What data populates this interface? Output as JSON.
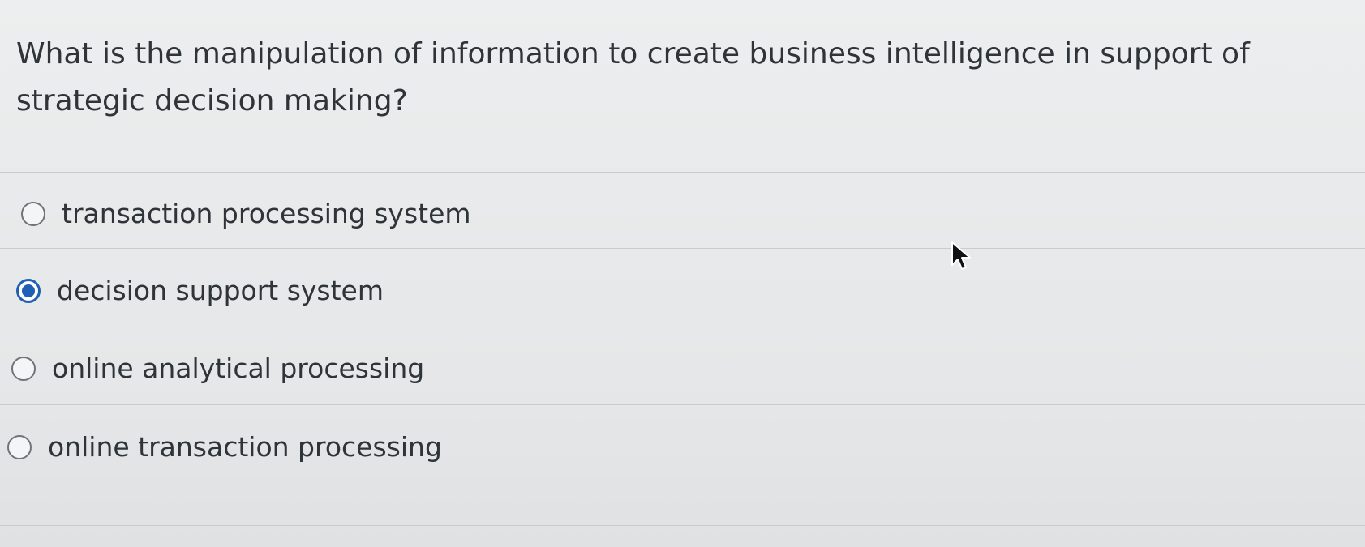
{
  "question": {
    "text": "What is the manipulation of information to create business intelligence in support of strategic decision making?"
  },
  "options": [
    {
      "label": "transaction processing system",
      "selected": false
    },
    {
      "label": "decision support system",
      "selected": true
    },
    {
      "label": "online analytical processing",
      "selected": false
    },
    {
      "label": "online transaction processing",
      "selected": false
    }
  ],
  "colors": {
    "accent": "#1f5fb4",
    "text": "#2e3438",
    "background": "#e8eaeb"
  },
  "icons": {
    "pointer": "mouse-cursor-icon",
    "unselected": "radio-empty-icon",
    "selected": "radio-selected-icon"
  }
}
